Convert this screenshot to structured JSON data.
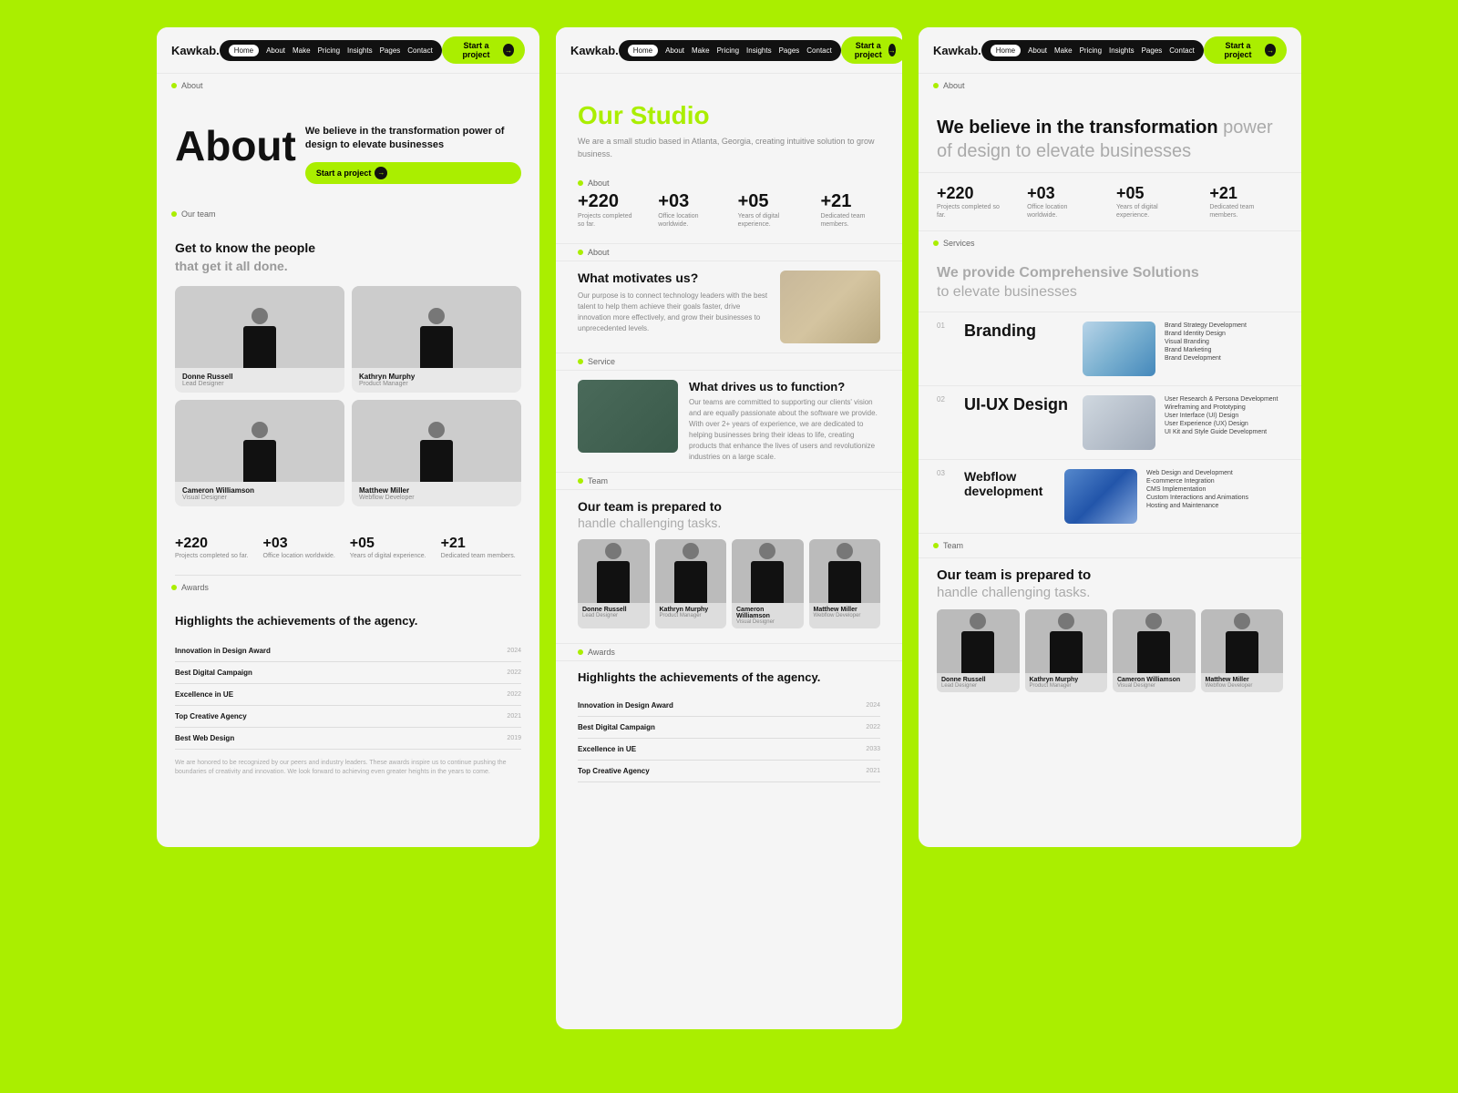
{
  "brand": "Kawkab.",
  "nav": {
    "items": [
      "Home",
      "About",
      "Make",
      "Pricing",
      "Insights",
      "Pages",
      "Contact"
    ],
    "active": "Home",
    "cta": "Start a project"
  },
  "left": {
    "about_label": "About",
    "hero_title": "About",
    "hero_text_bold": "We believe in the",
    "hero_text_bold2": "transformation",
    "hero_text_rest": "power of design to elevate businesses",
    "cta": "Start a project",
    "team_label": "Our team",
    "team_heading": "Get to know the people",
    "team_sub": "that get it all done.",
    "members": [
      {
        "name": "Donne Russell",
        "role": "Lead Designer"
      },
      {
        "name": "Kathryn Murphy",
        "role": "Product Manager"
      },
      {
        "name": "Cameron Williamson",
        "role": "Visual Designer"
      },
      {
        "name": "Matthew Miller",
        "role": "Webflow Developer"
      }
    ],
    "stats": [
      {
        "number": "+220",
        "label": "Projects completed so far."
      },
      {
        "number": "+03",
        "label": "Office location worldwide."
      },
      {
        "number": "+05",
        "label": "Years of digital experience."
      },
      {
        "number": "+21",
        "label": "Dedicated team members."
      }
    ],
    "awards_label": "Awards",
    "awards_heading_em": "Highlights the achievements",
    "awards_heading_rest": "of the agency.",
    "awards": [
      {
        "name": "Innovation in Design Award",
        "year": "2024"
      },
      {
        "name": "Best Digital Campaign",
        "year": "2022"
      },
      {
        "name": "Excellence in UE",
        "year": "2022"
      },
      {
        "name": "Top Creative Agency",
        "year": "2021"
      },
      {
        "name": "Best Web Design",
        "year": "2019"
      }
    ],
    "awards_desc": "We are honored to be recognized by our peers and industry leaders. These awards inspire us to continue pushing the boundaries of creativity and innovation. We look forward to achieving even greater heights in the years to come."
  },
  "center": {
    "title_our": "Our",
    "title_studio": "Studio",
    "subtitle": "We are a small studio based in Atlanta, Georgia, creating intuitive solution to grow business.",
    "about_label": "About",
    "stats": [
      {
        "number": "+220",
        "label": "Projects completed so far."
      },
      {
        "number": "+03",
        "label": "Office location worldwide."
      },
      {
        "number": "+05",
        "label": "Years of digital experience."
      },
      {
        "number": "+21",
        "label": "Dedicated team members."
      }
    ],
    "about_label2": "About",
    "motivates_title": "What motivates us?",
    "motivates_desc": "Our purpose is to connect technology leaders with the best talent to help them achieve their goals faster, drive innovation more effectively, and grow their businesses to unprecedented levels.",
    "service_label": "Service",
    "drives_title": "What drives us to function?",
    "drives_desc": "Our teams are committed to supporting our clients' vision and are equally passionate about the software we provide. With over 2+ years of experience, we are dedicated to helping businesses bring their ideas to life, creating products that enhance the lives of users and revolutionize industries on a large scale.",
    "team_label": "Team",
    "team_heading": "Our team is prepared to",
    "team_sub": "handle challenging tasks.",
    "members": [
      {
        "name": "Donne Russell",
        "role": "Lead Designer"
      },
      {
        "name": "Kathryn Murphy",
        "role": "Product Manager"
      },
      {
        "name": "Cameron Williamson",
        "role": "Visual Designer"
      },
      {
        "name": "Matthew Miller",
        "role": "Webflow Developer"
      }
    ],
    "awards_label": "Awards",
    "awards_heading": "Highlights the achievements of the agency.",
    "awards": [
      {
        "name": "Innovation in Design Award",
        "year": "2024"
      },
      {
        "name": "Best Digital Campaign",
        "year": "2022"
      },
      {
        "name": "Excellence in UE",
        "year": "2033"
      },
      {
        "name": "Top Creative Agency",
        "year": "2021"
      }
    ]
  },
  "right": {
    "about_label": "About",
    "belief_bold": "We believe in the",
    "belief_transform": "transformation",
    "belief_rest": "power of design to elevate businesses",
    "stats": [
      {
        "number": "+220",
        "label": "Projects completed so far."
      },
      {
        "number": "+03",
        "label": "Office location worldwide."
      },
      {
        "number": "+05",
        "label": "Years of digital experience."
      },
      {
        "number": "+21",
        "label": "Dedicated team members."
      }
    ],
    "services_label": "Services",
    "services_heading": "We provide Comprehensive Solutions",
    "services_heading_rest": "to elevate businesses",
    "services": [
      {
        "num": "01",
        "name": "Branding",
        "items": [
          "Brand Strategy Development",
          "Brand Identity Design",
          "Visual Branding",
          "Brand Marketing",
          "Brand Development"
        ],
        "img_class": "service-img-branding"
      },
      {
        "num": "02",
        "name": "UI-UX  Design",
        "items": [
          "User Research & Persona Development",
          "Wireframing and Prototyping",
          "User Interface (UI) Design",
          "User Experience (UX) Design",
          "UI Kit and Style Guide Development"
        ],
        "img_class": "service-img-ui"
      },
      {
        "num": "03",
        "name": "Webflow development",
        "items": [
          "Web Design and Development",
          "E-commerce Integration",
          "CMS Implementation",
          "Custom Interactions and Animations",
          "Hosting and Maintenance"
        ],
        "img_class": "service-img-webflow"
      }
    ],
    "team_label": "Team",
    "team_heading": "Our team is prepared to",
    "team_sub": "handle challenging tasks.",
    "members": [
      {
        "name": "Donne Russell",
        "role": "Lead Designer"
      },
      {
        "name": "Kathryn Murphy",
        "role": "Product Manager"
      },
      {
        "name": "Cameron Williamson",
        "role": "Visual Designer"
      },
      {
        "name": "Matthew Miller",
        "role": "Webflow Developer"
      }
    ]
  }
}
